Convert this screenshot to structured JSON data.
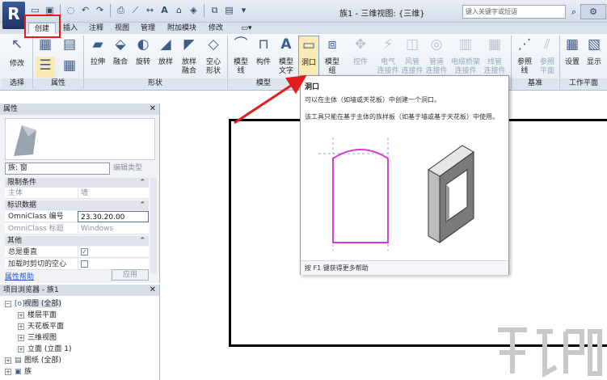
{
  "titlebar": {
    "app_logo": "R",
    "window_title": "族1 - 三维视图: {三维}",
    "search_placeholder": "键入关键字或短语",
    "qat_icons": [
      "open-icon",
      "save-icon",
      "sync-icon",
      "undo-icon",
      "redo-icon",
      "print-icon",
      "measure-icon",
      "text-icon",
      "default-3d-icon",
      "close-hidden-icon",
      "switch-windows-icon"
    ]
  },
  "tabs": [
    "创建",
    "插入",
    "注释",
    "视图",
    "管理",
    "附加模块",
    "修改"
  ],
  "ribbon": {
    "select": {
      "modify": "修改",
      "panel": "选择"
    },
    "properties_panel": "属性",
    "forms": {
      "extrusion": "拉伸",
      "blend": "融合",
      "revolve": "旋转",
      "sweep": "放样",
      "swept_blend": "放样\n融合",
      "void": "空心\n形状",
      "panel": "形状"
    },
    "model": {
      "model_line": "模型\n线",
      "component": "构件",
      "model_text": "模型\n文字",
      "opening": "洞口",
      "model_group": "模型\n组",
      "panel": "模型"
    },
    "control": {
      "control": "控件"
    },
    "connectors": {
      "electrical": "电气\n连接件",
      "duct": "风管\n连接件",
      "pipe": "管道\n连接件",
      "cable_tray": "电缆桥架\n连接件",
      "conduit": "线管\n连接件"
    },
    "datum": {
      "ref_line": "参照\n线",
      "ref_plane": "参照\n平面",
      "panel": "基准"
    },
    "work_plane": {
      "set": "设置",
      "show": "显示",
      "panel": "工作平面"
    }
  },
  "properties": {
    "title": "属性",
    "type_select": "族: 窗",
    "edit_type": "编辑类型",
    "groups": [
      {
        "name": "限制条件",
        "rows": [
          {
            "key": "主体",
            "value": "墙"
          }
        ]
      },
      {
        "name": "标识数据",
        "rows": [
          {
            "key": "OmniClass 编号",
            "value": "23.30.20.00"
          },
          {
            "key": "OmniClass 标题",
            "value": "Windows"
          }
        ]
      },
      {
        "name": "其他",
        "rows": [
          {
            "key": "总是垂直",
            "value": "✓"
          },
          {
            "key": "加载时剪切的空心",
            "value": ""
          }
        ]
      }
    ],
    "help_link": "属性帮助",
    "apply_button": "应用"
  },
  "project_browser": {
    "title": "项目浏览器 - 族1",
    "items": [
      {
        "label": "视图 (全部)",
        "level": 0,
        "expanded": true,
        "highlighted": true
      },
      {
        "label": "楼层平面",
        "level": 1
      },
      {
        "label": "天花板平面",
        "level": 1
      },
      {
        "label": "三维视图",
        "level": 1
      },
      {
        "label": "立面 (立面 1)",
        "level": 1
      },
      {
        "label": "图纸 (全部)",
        "level": 0
      },
      {
        "label": "族",
        "level": 0
      }
    ]
  },
  "tooltip": {
    "title": "洞口",
    "desc1": "可以在主体（如墙或天花板）中创建一个洞口。",
    "desc2": "该工具只能在基于主体的族样板（如基于墙或基于天花板）中使用。",
    "footer": "按 F1 键获得更多帮助"
  },
  "colors": {
    "opening_outline": "#d63ad6",
    "highlight_red": "#e21d1d",
    "ribbon_blue": "#3d5c8c"
  }
}
